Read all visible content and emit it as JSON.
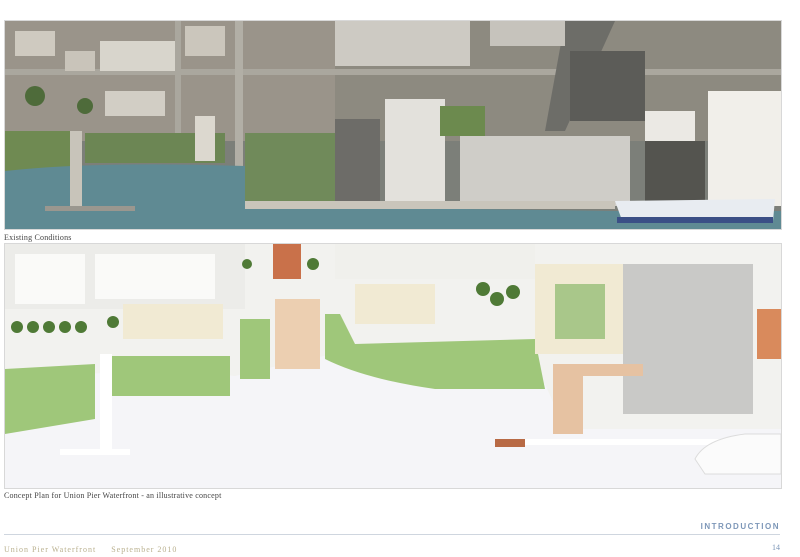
{
  "captions": {
    "existing": "Existing Conditions",
    "concept": "Concept Plan for Union Pier Waterfront - an illustrative concept"
  },
  "section": "INTRODUCTION",
  "footer": {
    "project": "Union Pier Waterfront",
    "date": "September 2010",
    "page": "14"
  },
  "colors": {
    "water_aerial": "#5f8a93",
    "water_plan": "#f4f4f6",
    "lawn": "#9fc77a",
    "accent": "#7d97b8"
  }
}
